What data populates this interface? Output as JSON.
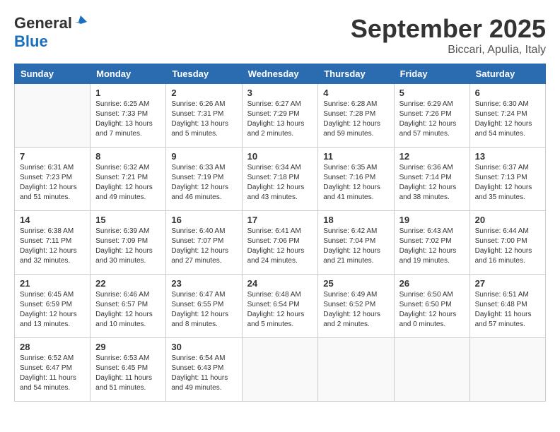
{
  "header": {
    "logo_general": "General",
    "logo_blue": "Blue",
    "month_year": "September 2025",
    "location": "Biccari, Apulia, Italy"
  },
  "days_of_week": [
    "Sunday",
    "Monday",
    "Tuesday",
    "Wednesday",
    "Thursday",
    "Friday",
    "Saturday"
  ],
  "weeks": [
    [
      {
        "day": "",
        "info": ""
      },
      {
        "day": "1",
        "info": "Sunrise: 6:25 AM\nSunset: 7:33 PM\nDaylight: 13 hours\nand 7 minutes."
      },
      {
        "day": "2",
        "info": "Sunrise: 6:26 AM\nSunset: 7:31 PM\nDaylight: 13 hours\nand 5 minutes."
      },
      {
        "day": "3",
        "info": "Sunrise: 6:27 AM\nSunset: 7:29 PM\nDaylight: 13 hours\nand 2 minutes."
      },
      {
        "day": "4",
        "info": "Sunrise: 6:28 AM\nSunset: 7:28 PM\nDaylight: 12 hours\nand 59 minutes."
      },
      {
        "day": "5",
        "info": "Sunrise: 6:29 AM\nSunset: 7:26 PM\nDaylight: 12 hours\nand 57 minutes."
      },
      {
        "day": "6",
        "info": "Sunrise: 6:30 AM\nSunset: 7:24 PM\nDaylight: 12 hours\nand 54 minutes."
      }
    ],
    [
      {
        "day": "7",
        "info": "Sunrise: 6:31 AM\nSunset: 7:23 PM\nDaylight: 12 hours\nand 51 minutes."
      },
      {
        "day": "8",
        "info": "Sunrise: 6:32 AM\nSunset: 7:21 PM\nDaylight: 12 hours\nand 49 minutes."
      },
      {
        "day": "9",
        "info": "Sunrise: 6:33 AM\nSunset: 7:19 PM\nDaylight: 12 hours\nand 46 minutes."
      },
      {
        "day": "10",
        "info": "Sunrise: 6:34 AM\nSunset: 7:18 PM\nDaylight: 12 hours\nand 43 minutes."
      },
      {
        "day": "11",
        "info": "Sunrise: 6:35 AM\nSunset: 7:16 PM\nDaylight: 12 hours\nand 41 minutes."
      },
      {
        "day": "12",
        "info": "Sunrise: 6:36 AM\nSunset: 7:14 PM\nDaylight: 12 hours\nand 38 minutes."
      },
      {
        "day": "13",
        "info": "Sunrise: 6:37 AM\nSunset: 7:13 PM\nDaylight: 12 hours\nand 35 minutes."
      }
    ],
    [
      {
        "day": "14",
        "info": "Sunrise: 6:38 AM\nSunset: 7:11 PM\nDaylight: 12 hours\nand 32 minutes."
      },
      {
        "day": "15",
        "info": "Sunrise: 6:39 AM\nSunset: 7:09 PM\nDaylight: 12 hours\nand 30 minutes."
      },
      {
        "day": "16",
        "info": "Sunrise: 6:40 AM\nSunset: 7:07 PM\nDaylight: 12 hours\nand 27 minutes."
      },
      {
        "day": "17",
        "info": "Sunrise: 6:41 AM\nSunset: 7:06 PM\nDaylight: 12 hours\nand 24 minutes."
      },
      {
        "day": "18",
        "info": "Sunrise: 6:42 AM\nSunset: 7:04 PM\nDaylight: 12 hours\nand 21 minutes."
      },
      {
        "day": "19",
        "info": "Sunrise: 6:43 AM\nSunset: 7:02 PM\nDaylight: 12 hours\nand 19 minutes."
      },
      {
        "day": "20",
        "info": "Sunrise: 6:44 AM\nSunset: 7:00 PM\nDaylight: 12 hours\nand 16 minutes."
      }
    ],
    [
      {
        "day": "21",
        "info": "Sunrise: 6:45 AM\nSunset: 6:59 PM\nDaylight: 12 hours\nand 13 minutes."
      },
      {
        "day": "22",
        "info": "Sunrise: 6:46 AM\nSunset: 6:57 PM\nDaylight: 12 hours\nand 10 minutes."
      },
      {
        "day": "23",
        "info": "Sunrise: 6:47 AM\nSunset: 6:55 PM\nDaylight: 12 hours\nand 8 minutes."
      },
      {
        "day": "24",
        "info": "Sunrise: 6:48 AM\nSunset: 6:54 PM\nDaylight: 12 hours\nand 5 minutes."
      },
      {
        "day": "25",
        "info": "Sunrise: 6:49 AM\nSunset: 6:52 PM\nDaylight: 12 hours\nand 2 minutes."
      },
      {
        "day": "26",
        "info": "Sunrise: 6:50 AM\nSunset: 6:50 PM\nDaylight: 12 hours\nand 0 minutes."
      },
      {
        "day": "27",
        "info": "Sunrise: 6:51 AM\nSunset: 6:48 PM\nDaylight: 11 hours\nand 57 minutes."
      }
    ],
    [
      {
        "day": "28",
        "info": "Sunrise: 6:52 AM\nSunset: 6:47 PM\nDaylight: 11 hours\nand 54 minutes."
      },
      {
        "day": "29",
        "info": "Sunrise: 6:53 AM\nSunset: 6:45 PM\nDaylight: 11 hours\nand 51 minutes."
      },
      {
        "day": "30",
        "info": "Sunrise: 6:54 AM\nSunset: 6:43 PM\nDaylight: 11 hours\nand 49 minutes."
      },
      {
        "day": "",
        "info": ""
      },
      {
        "day": "",
        "info": ""
      },
      {
        "day": "",
        "info": ""
      },
      {
        "day": "",
        "info": ""
      }
    ]
  ]
}
